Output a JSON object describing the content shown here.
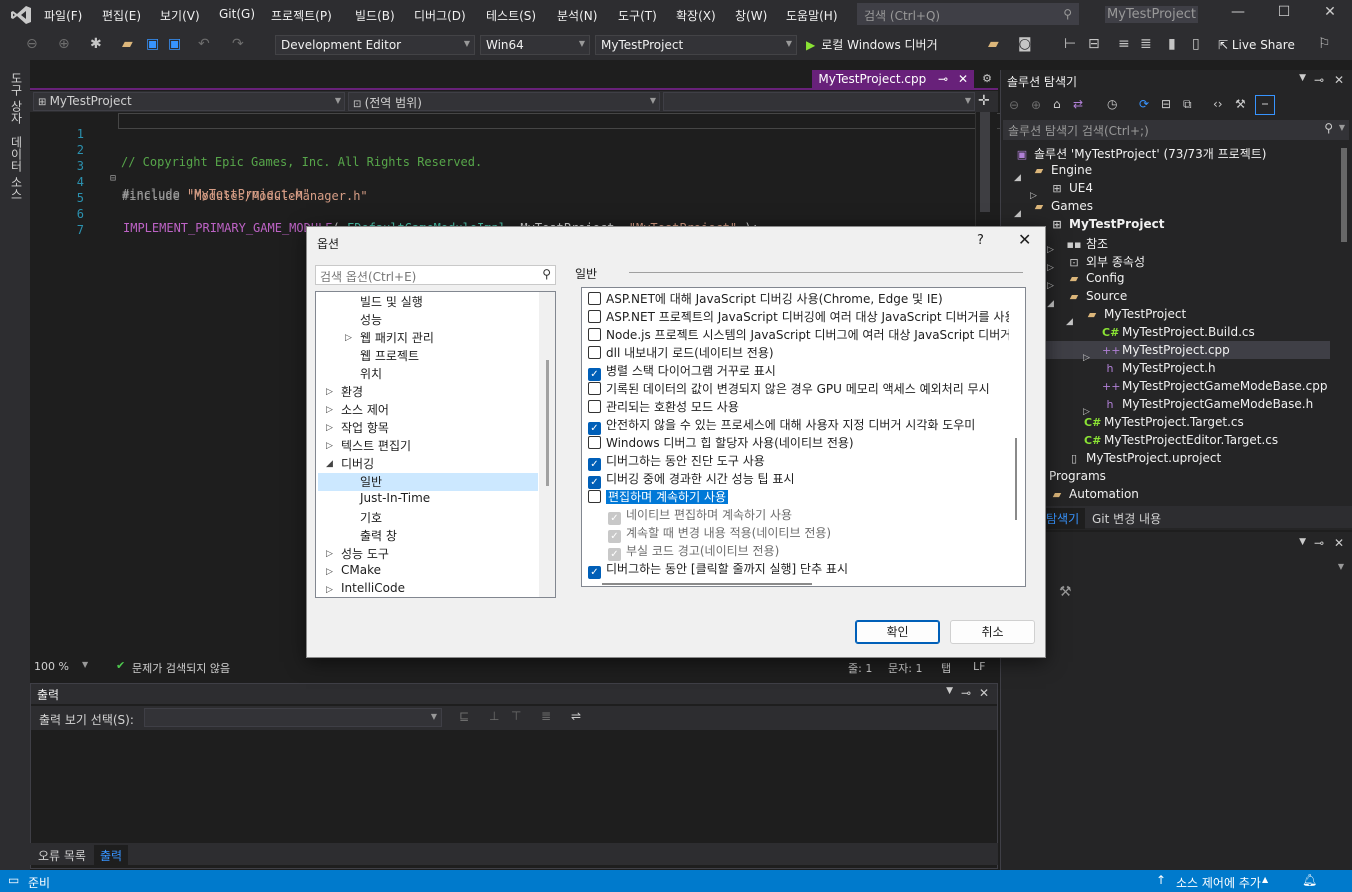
{
  "menubar": {
    "items": [
      "파일(F)",
      "편집(E)",
      "보기(V)",
      "Git(G)",
      "프로젝트(P)",
      "빌드(B)",
      "디버그(D)",
      "테스트(S)",
      "분석(N)",
      "도구(T)",
      "확장(X)",
      "창(W)",
      "도움말(H)"
    ],
    "search_placeholder": "검색 (Ctrl+Q)",
    "window_title": "MyTestProject"
  },
  "toolbar": {
    "config": "Development Editor",
    "platform": "Win64",
    "project": "MyTestProject",
    "run_label": "로컬 Windows 디버거",
    "live_share": "Live Share"
  },
  "side_tabs": [
    "도구 상자",
    "데이터 소스"
  ],
  "editor": {
    "tab_name": "MyTestProject.cpp",
    "nav_project": "MyTestProject",
    "nav_scope": "(전역 범위)",
    "nav_member": "",
    "lines": [
      {
        "num": "1",
        "comment": "// Copyright Epic Games, Inc. All Rights Reserved."
      },
      {
        "num": "2"
      },
      {
        "num": "3",
        "pp": "#include",
        "str": "\"MyTestProject.h\""
      },
      {
        "num": "4",
        "pp": "#include",
        "str": "\"Modules/ModuleManager.h\""
      },
      {
        "num": "5"
      },
      {
        "num": "6",
        "macro": "IMPLEMENT_PRIMARY_GAME_MODULE",
        "p1": "( ",
        "type": "FDefaultGameModuleImpl",
        "p2": ", MyTestProject, ",
        "str": "\"MyTestProject\"",
        "p3": " );"
      },
      {
        "num": "7"
      }
    ],
    "zoom": "100 %",
    "issues": "문제가 검색되지 않음",
    "line_col": "줄: 1",
    "char_col": "문자: 1",
    "indent": "탭",
    "eol": "LF"
  },
  "output": {
    "title": "출력",
    "source_label": "출력 보기 선택(S):",
    "source_value": "",
    "tabs": [
      "오류 목록",
      "출력"
    ]
  },
  "solution": {
    "title": "솔루션 탐색기",
    "search_placeholder": "솔루션 탐색기 검색(Ctrl+;)",
    "tree": [
      {
        "label": "솔루션 'MyTestProject' (73/73개 프로젝트)",
        "icon": "solution-icon",
        "bold": false
      },
      {
        "label": "Engine",
        "icon": "folder-icon"
      },
      {
        "label": "UE4",
        "icon": "project-icon"
      },
      {
        "label": "Games",
        "icon": "folder-icon"
      },
      {
        "label": "MyTestProject",
        "icon": "project-icon",
        "bold": true
      },
      {
        "label": "참조",
        "icon": "references-icon"
      },
      {
        "label": "외부 종속성",
        "icon": "dependencies-icon"
      },
      {
        "label": "Config",
        "icon": "folder-icon"
      },
      {
        "label": "Source",
        "icon": "folder-icon"
      },
      {
        "label": "MyTestProject",
        "icon": "folder-icon"
      },
      {
        "label": "MyTestProject.Build.cs",
        "icon": "csharp-file-icon"
      },
      {
        "label": "MyTestProject.cpp",
        "icon": "cpp-file-icon"
      },
      {
        "label": "MyTestProject.h",
        "icon": "header-file-icon"
      },
      {
        "label": "MyTestProjectGameModeBase.cpp",
        "icon": "cpp-file-icon"
      },
      {
        "label": "MyTestProjectGameModeBase.h",
        "icon": "header-file-icon"
      },
      {
        "label": "MyTestProject.Target.cs",
        "icon": "csharp-file-icon"
      },
      {
        "label": "MyTestProjectEditor.Target.cs",
        "icon": "csharp-file-icon"
      },
      {
        "label": "MyTestProject.uproject",
        "icon": "file-icon"
      },
      {
        "label": "Programs",
        "icon": "folder-icon"
      },
      {
        "label": "Automation",
        "icon": "folder-icon"
      }
    ],
    "tabs": [
      "탐색기",
      "Git 변경 내용"
    ]
  },
  "statusbar": {
    "status": "준비",
    "source_control": "소스 제어에 추가"
  },
  "dialog": {
    "title": "옵션",
    "help": "?",
    "search_placeholder": "검색 옵션(Ctrl+E)",
    "section_title": "일반",
    "tree": [
      {
        "label": "빌드 및 실행",
        "level": 2,
        "exp": false
      },
      {
        "label": "성능",
        "level": 2,
        "exp": false
      },
      {
        "label": "웹 패키지 관리",
        "level": 2,
        "exp": true
      },
      {
        "label": "웹 프로젝트",
        "level": 2,
        "exp": false
      },
      {
        "label": "위치",
        "level": 2,
        "exp": false
      },
      {
        "label": "환경",
        "level": 1,
        "exp": true
      },
      {
        "label": "소스 제어",
        "level": 1,
        "exp": true
      },
      {
        "label": "작업 항목",
        "level": 1,
        "exp": true
      },
      {
        "label": "텍스트 편집기",
        "level": 1,
        "exp": true
      },
      {
        "label": "디버깅",
        "level": 1,
        "exp": true,
        "open": true
      },
      {
        "label": "일반",
        "level": 2,
        "exp": false,
        "selected": true
      },
      {
        "label": "Just-In-Time",
        "level": 2,
        "exp": false
      },
      {
        "label": "기호",
        "level": 2,
        "exp": false
      },
      {
        "label": "출력 창",
        "level": 2,
        "exp": false
      },
      {
        "label": "성능 도구",
        "level": 1,
        "exp": true
      },
      {
        "label": "CMake",
        "level": 1,
        "exp": true
      },
      {
        "label": "IntelliCode",
        "level": 1,
        "exp": true
      }
    ],
    "options": [
      {
        "label": "ASP.NET에 대해 JavaScript 디버깅 사용(Chrome, Edge 및 IE)",
        "state": "off"
      },
      {
        "label": "ASP.NET 프로젝트의 JavaScript 디버깅에 여러 대상 JavaScript 디버거를 사용",
        "state": "off"
      },
      {
        "label": "Node.js 프로젝트 시스템의 JavaScript 디버그에 여러 대상 JavaScript 디버거",
        "state": "off"
      },
      {
        "label": "dll 내보내기 로드(네이티브 전용)",
        "state": "off"
      },
      {
        "label": "병렬 스택 다이어그램 거꾸로 표시",
        "state": "on"
      },
      {
        "label": "기록된 데이터의 값이 변경되지 않은 경우 GPU 메모리 액세스 예외처리 무시",
        "state": "off"
      },
      {
        "label": "관리되는 호환성 모드 사용",
        "state": "off"
      },
      {
        "label": "안전하지 않을 수 있는 프로세스에 대해 사용자 지정 디버거 시각화 도우미",
        "state": "on"
      },
      {
        "label": "Windows 디버그 힙 할당자 사용(네이티브 전용)",
        "state": "off"
      },
      {
        "label": "디버그하는 동안 진단 도구 사용",
        "state": "on"
      },
      {
        "label": "디버깅 중에 경과한 시간 성능 팁 표시",
        "state": "on"
      },
      {
        "label": "편집하며 계속하기 사용",
        "state": "off",
        "highlight": true
      },
      {
        "label": "네이티브 편집하며 계속하기 사용",
        "state": "dis",
        "sub": true
      },
      {
        "label": "계속할 때 변경 내용 적용(네이티브 전용)",
        "state": "dis",
        "sub": true
      },
      {
        "label": "부실 코드 경고(네이티브 전용)",
        "state": "dis",
        "sub": true
      },
      {
        "label": "디버그하는 동안 [클릭할 줄까지 실행] 단추 표시",
        "state": "on"
      }
    ],
    "ok": "확인",
    "cancel": "취소"
  }
}
